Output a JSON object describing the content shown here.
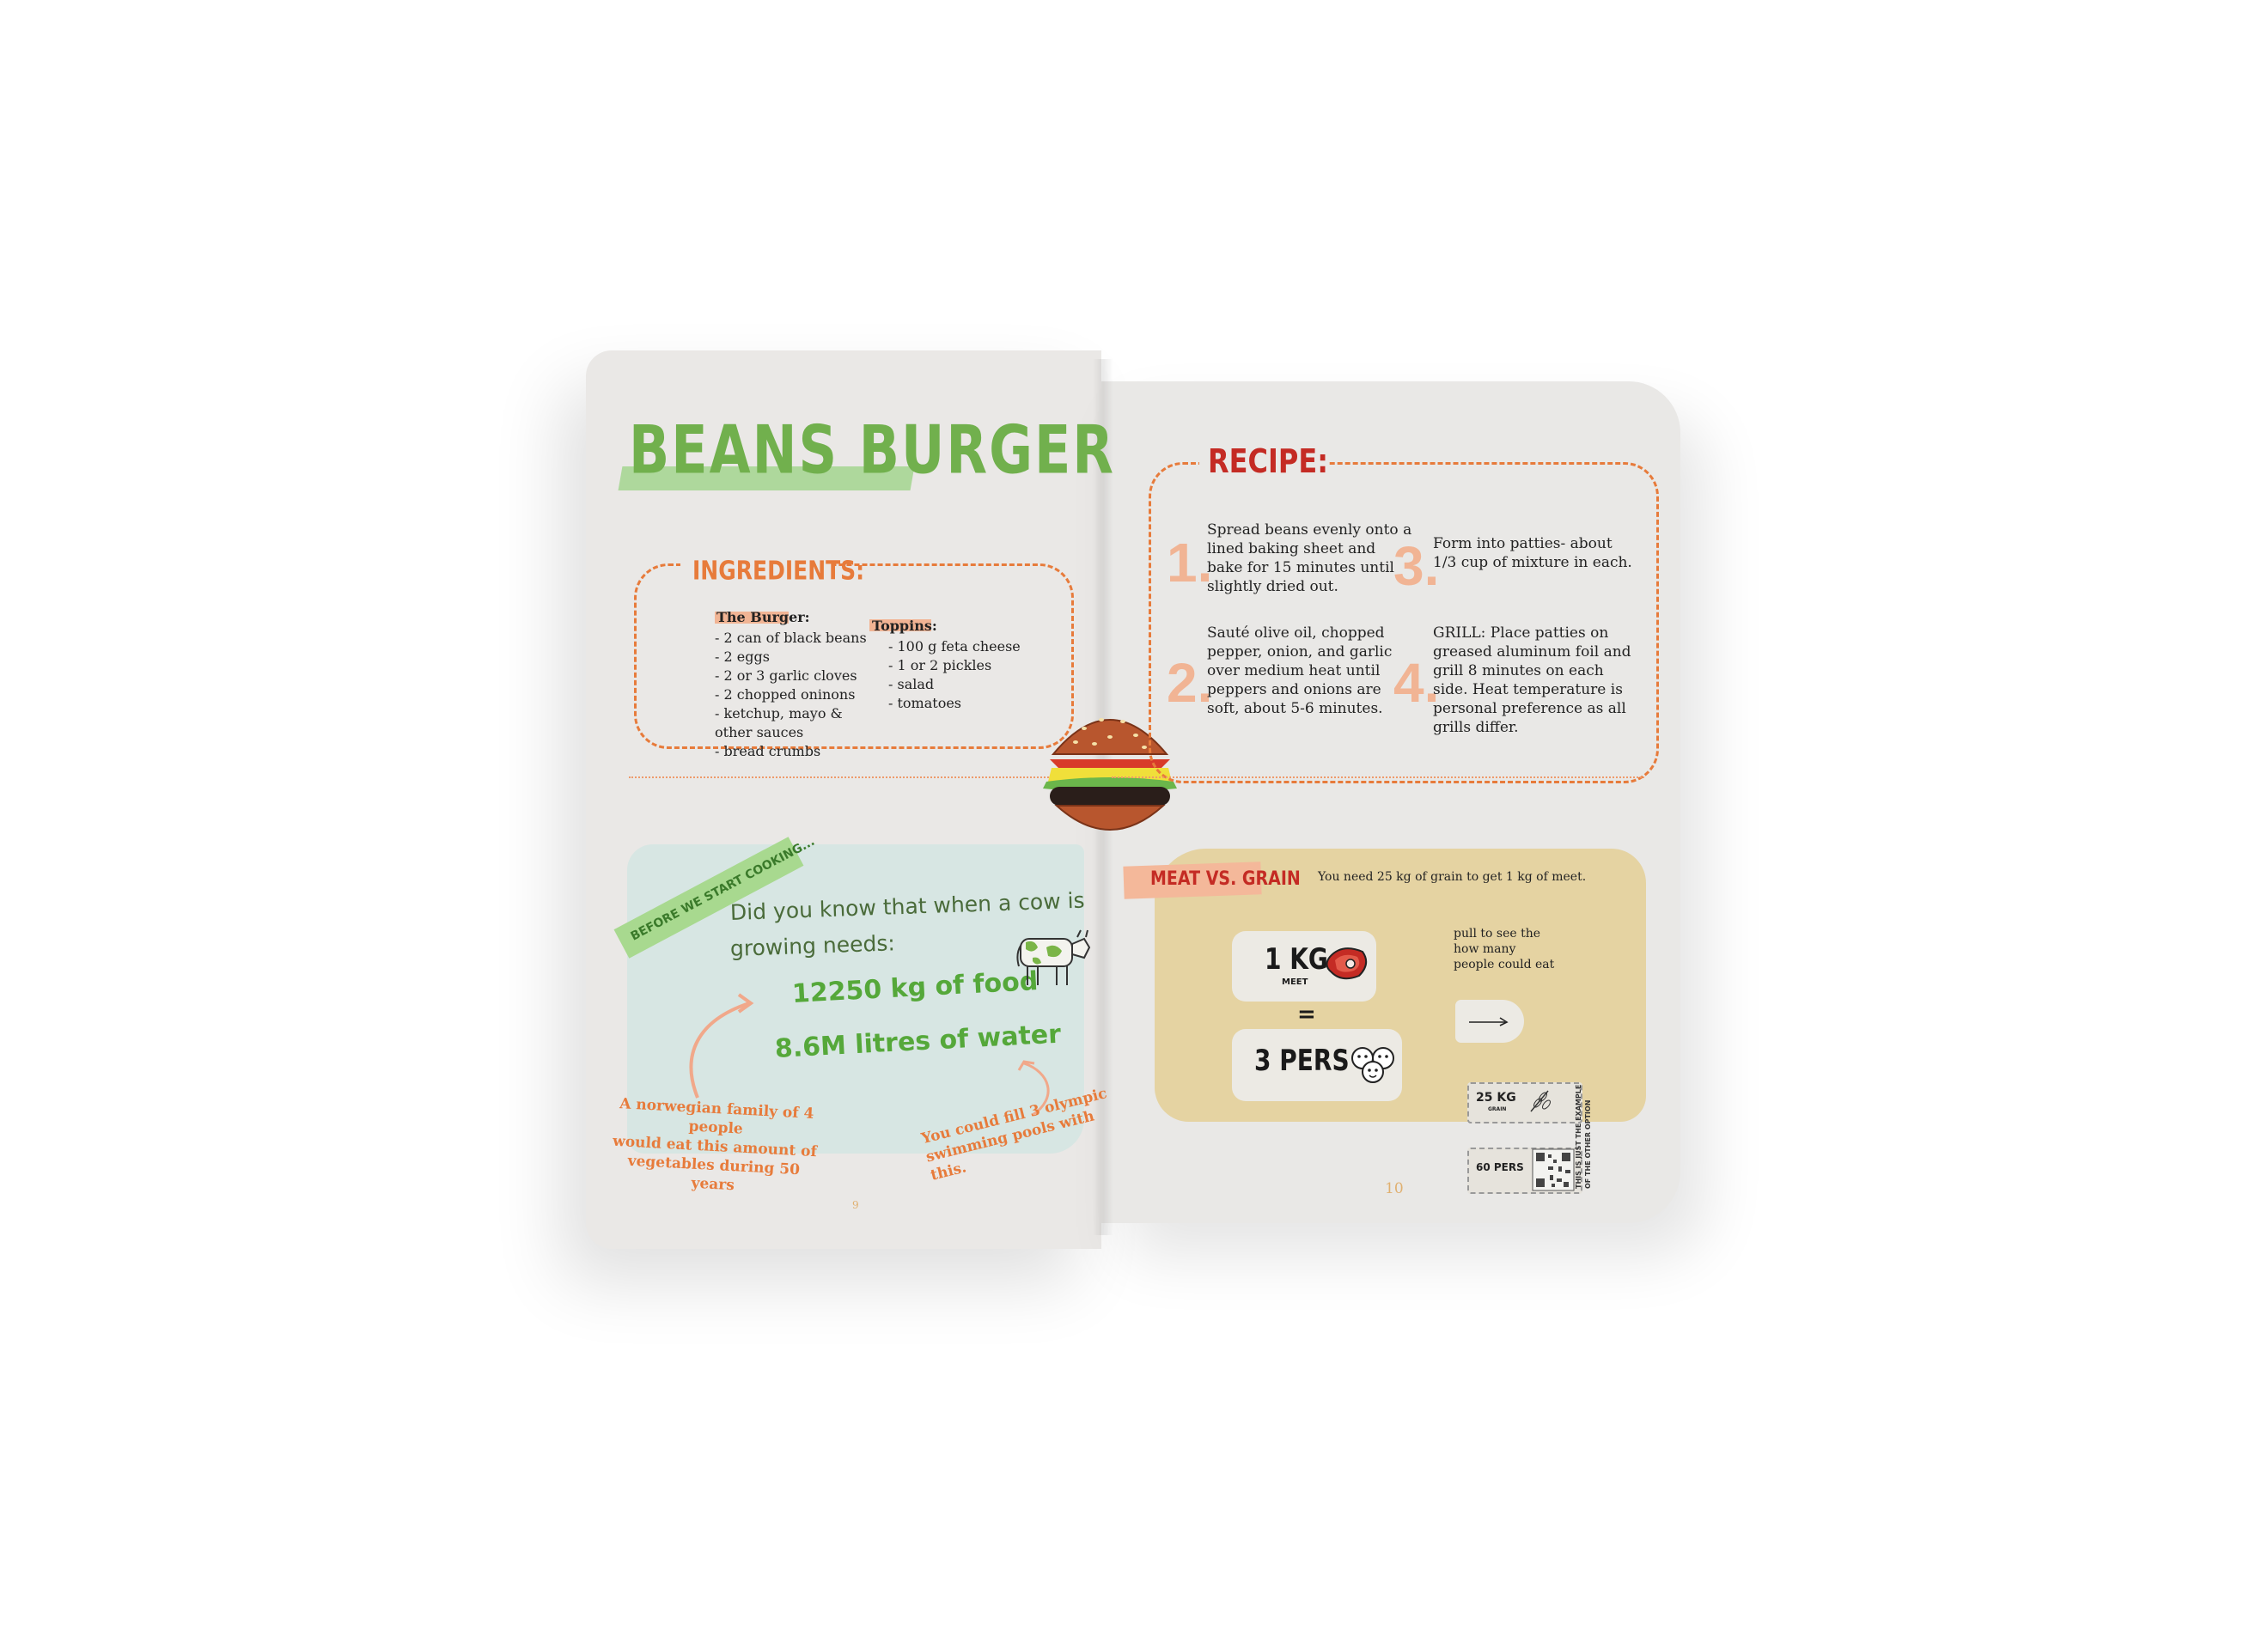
{
  "left_page": {
    "title": "BEANS BURGER",
    "ingredients": {
      "heading": "INGREDIENTS:",
      "burger_heading": "The Burger:",
      "burger_items": [
        "- 2 can of black beans",
        "- 2 eggs",
        "- 2 or 3 garlic cloves",
        "- 2 chopped oninons",
        "- ketchup, mayo &",
        "other sauces",
        "- bread crumbs"
      ],
      "toppings_heading": "Toppins:",
      "toppings_items": [
        "- 100 g feta cheese",
        "- 1 or 2 pickles",
        "- salad",
        "- tomatoes"
      ]
    },
    "before_tag": "BEFORE WE START COOKING...",
    "fact_line1": "Did you know that when a cow is",
    "fact_line2": "growing needs:",
    "stat_food": "12250 kg of food",
    "stat_water": "8.6M litres of water",
    "note_family": [
      "A norwegian family of 4 people",
      "would eat this amount of",
      "vegetables during 50 years"
    ],
    "note_pools": [
      "You could fill 3 olympic",
      "swimming pools with",
      "this."
    ],
    "page_number": "9"
  },
  "right_page": {
    "recipe_heading": "RECIPE:",
    "steps": [
      {
        "num": "1.",
        "text": [
          "Spread beans evenly onto a",
          "lined baking sheet and",
          "bake for 15 minutes until",
          "slightly dried out."
        ]
      },
      {
        "num": "2.",
        "text": [
          "Sauté olive oil, chopped",
          "pepper, onion, and garlic",
          "over medium heat until",
          "peppers and onions are",
          "soft, about 5-6 minutes."
        ]
      },
      {
        "num": "3.",
        "text": [
          "Form into patties- about",
          "1/3 cup of mixture in each."
        ]
      },
      {
        "num": "4.",
        "text": [
          "GRILL: Place patties on",
          "greased aluminum foil and",
          "grill 8 minutes on each",
          "side. Heat temperature is",
          "personal preference as all",
          "grills differ."
        ]
      }
    ],
    "meat_tag": "MEAT VS. GRAIN",
    "meat_sentence": "You need 25 kg of grain to get 1 kg of meet.",
    "card_meat_value": "1 KG",
    "card_meat_sub": "MEET",
    "equals": "=",
    "card_pers_value": "3 PERS",
    "pull_text": [
      "pull to see the",
      "how many",
      "people could eat"
    ],
    "mini_grain": "25 KG",
    "mini_grain_sub": "GRAIN",
    "mini_pers": "60 PERS",
    "side_note": [
      "THIS IS JUST THE EXAMPLE",
      "OF THE OTHER OPTION"
    ],
    "page_number": "10"
  },
  "colors": {
    "green": "#7ab548",
    "green_dark": "#3f8a2c",
    "orange": "#e77b3b",
    "red": "#c42b24",
    "peach": "#f1b494",
    "tan": "#e8d6a6",
    "teal_wash": "#d5e5e2"
  },
  "icons": [
    "burger-illustration",
    "cow-illustration",
    "steak-icon",
    "people-faces-icon",
    "arrow-icon",
    "wheat-icon",
    "qr-code-icon"
  ]
}
